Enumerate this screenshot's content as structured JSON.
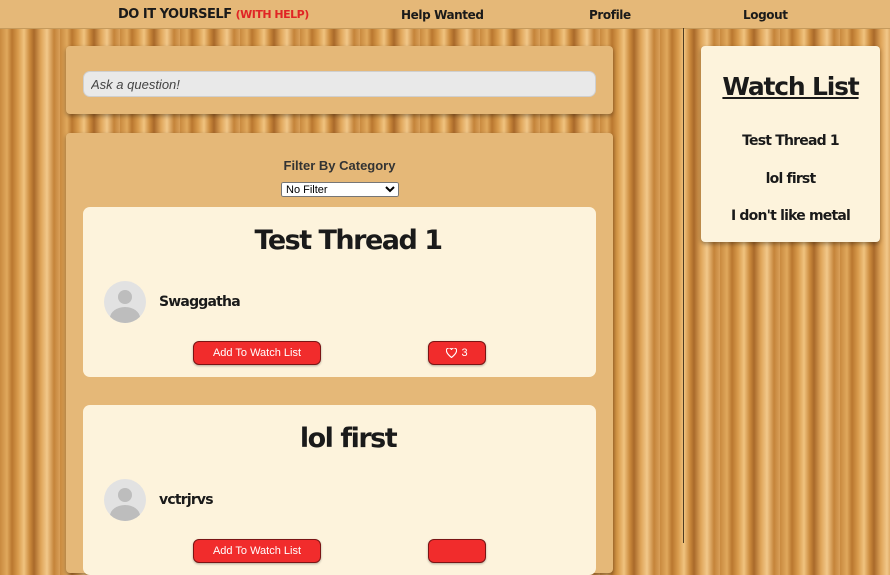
{
  "nav": {
    "logo_main": "DO IT YOURSELF",
    "logo_accent": "(WITH HELP)",
    "links": [
      "Help Wanted",
      "Profile",
      "Logout"
    ]
  },
  "ask": {
    "placeholder": "Ask a question!"
  },
  "filter": {
    "label": "Filter By Category",
    "selected": "No Filter"
  },
  "threads": [
    {
      "title": "Test Thread 1",
      "author": "Swaggatha",
      "watch_label": "Add To Watch List",
      "likes": "3"
    },
    {
      "title": "lol first",
      "author": "vctrjrvs",
      "watch_label": "Add To Watch List",
      "likes": ""
    }
  ],
  "watchlist": {
    "title": "Watch List",
    "items": [
      "Test Thread 1",
      "lol first",
      "I don't like metal"
    ]
  },
  "colors": {
    "accent_red": "#f12c2c",
    "panel": "#e5b878",
    "card": "#fdf3dc"
  },
  "icons": [
    "heart-icon",
    "avatar-icon",
    "chevron-down-icon"
  ]
}
